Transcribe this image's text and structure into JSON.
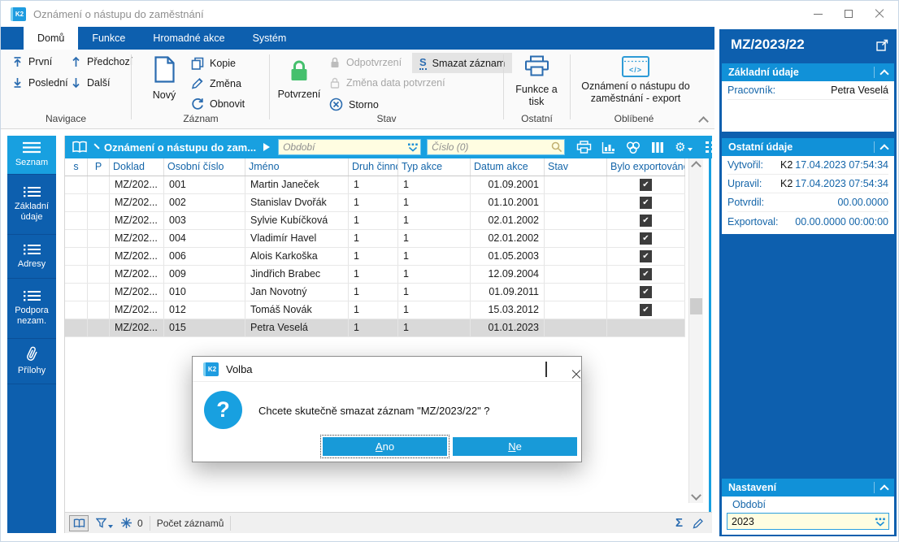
{
  "window": {
    "logo": "K2",
    "title": "Oznámení o nástupu do zaměstnání"
  },
  "tabs": [
    "Domů",
    "Funkce",
    "Hromadné akce",
    "Systém"
  ],
  "ribbon": {
    "navigace": {
      "label": "Navigace",
      "prvni": "První",
      "posledni": "Poslední",
      "predchozi": "Předchozí",
      "dalsi": "Další"
    },
    "zaznam": {
      "label": "Záznam",
      "novy": "Nový",
      "kopie": "Kopie",
      "zmena": "Změna",
      "obnovit": "Obnovit"
    },
    "stav": {
      "label": "Stav",
      "potvrzeni": "Potvrzení",
      "odpotvrzeni": "Odpotvrzení",
      "zmena_data": "Změna data potvrzení",
      "storno": "Storno",
      "smazat": "Smazat záznam"
    },
    "ostatni": {
      "label": "Ostatní",
      "funkce_tisk": "Funkce a tisk"
    },
    "oblibene": {
      "label": "Oblíbené",
      "export": "Oznámení o nástupu do zaměstnání - export"
    }
  },
  "sidebar": [
    "Seznam",
    "Základní údaje",
    "Adresy",
    "Podpora nezam.",
    "Přílohy"
  ],
  "grid": {
    "toolbar": {
      "title": "Oznámení o nástupu do zam...",
      "filter_obdobi": "Období",
      "filter_cislo": "Číslo (0)"
    },
    "columns": [
      "s",
      "P",
      "Doklad",
      "Osobní číslo",
      "Jméno",
      "Druh činnost",
      "Typ akce",
      "Datum akce",
      "Stav",
      "Bylo exportováno"
    ],
    "rows": [
      {
        "doklad": "MZ/202...",
        "cislo": "001",
        "jmeno": "Martin Janeček",
        "druh": "1",
        "typ": "1",
        "datum": "01.09.2001"
      },
      {
        "doklad": "MZ/202...",
        "cislo": "002",
        "jmeno": "Stanislav Dvořák",
        "druh": "1",
        "typ": "1",
        "datum": "01.10.2001"
      },
      {
        "doklad": "MZ/202...",
        "cislo": "003",
        "jmeno": "Sylvie Kubíčková",
        "druh": "1",
        "typ": "1",
        "datum": "02.01.2002"
      },
      {
        "doklad": "MZ/202...",
        "cislo": "004",
        "jmeno": "Vladimír Havel",
        "druh": "1",
        "typ": "1",
        "datum": "02.01.2002"
      },
      {
        "doklad": "MZ/202...",
        "cislo": "006",
        "jmeno": "Alois Karkoška",
        "druh": "1",
        "typ": "1",
        "datum": "01.05.2003"
      },
      {
        "doklad": "MZ/202...",
        "cislo": "009",
        "jmeno": "Jindřich Brabec",
        "druh": "1",
        "typ": "1",
        "datum": "12.09.2004"
      },
      {
        "doklad": "MZ/202...",
        "cislo": "010",
        "jmeno": "Jan Novotný",
        "druh": "1",
        "typ": "1",
        "datum": "01.09.2011"
      },
      {
        "doklad": "MZ/202...",
        "cislo": "012",
        "jmeno": "Tomáš Novák",
        "druh": "1",
        "typ": "1",
        "datum": "15.03.2012"
      },
      {
        "doklad": "MZ/202...",
        "cislo": "015",
        "jmeno": "Petra Veselá",
        "druh": "1",
        "typ": "1",
        "datum": "01.01.2023"
      }
    ],
    "status": {
      "count": "0",
      "records": "Počet záznamů"
    }
  },
  "panel": {
    "title": "MZ/2023/22",
    "zakladni": {
      "header": "Základní údaje",
      "pracovnik_label": "Pracovník:",
      "pracovnik_value": "Petra Veselá"
    },
    "ostatni": {
      "header": "Ostatní údaje",
      "vytvoril_label": "Vytvořil:",
      "vytvoril_prefix": "K2",
      "vytvoril_value": "17.04.2023 07:54:34",
      "upravil_label": "Upravil:",
      "upravil_prefix": "K2",
      "upravil_value": "17.04.2023 07:54:34",
      "potvrdil_label": "Potvrdil:",
      "potvrdil_value": "00.00.0000",
      "exportoval_label": "Exportoval:",
      "exportoval_value": "00.00.0000 00:00:00"
    },
    "nastaveni": {
      "header": "Nastavení",
      "obdobi_label": "Období",
      "obdobi_value": "2023"
    }
  },
  "dialog": {
    "title": "Volba",
    "message": "Chcete skutečně smazat záznam \"MZ/2023/22\" ?",
    "yes_key": "A",
    "yes_rest": "no",
    "no_key": "N",
    "no_rest": "e"
  },
  "icons": {
    "check": "✔",
    "sigma": "Σ",
    "gear": "⚙",
    "question": "?",
    "smazat_key": "S",
    "export_glyph": "</>"
  },
  "colors": {
    "dark_blue": "#0d5fae",
    "cyan": "#18a0e0",
    "accent_blue": "#1465a9",
    "input_yellow": "#fffde1",
    "confirm_green": "#45c06d"
  }
}
